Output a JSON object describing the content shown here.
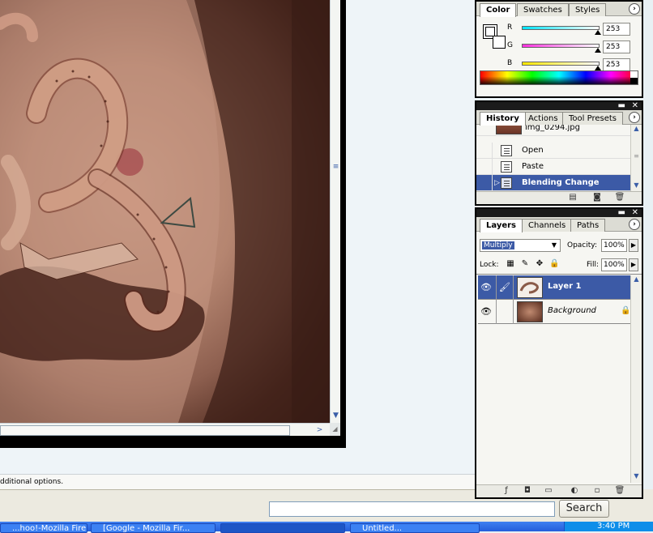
{
  "status_bar": {
    "text": "dditional options."
  },
  "browser": {
    "search_label": "Search"
  },
  "taskbar": {
    "items": [
      "...hoo!-Mozilla Fire...",
      "[Google - Mozilla Fir...",
      "",
      "Untitled..."
    ],
    "clock": "3:40 PM"
  },
  "color_palette": {
    "tabs": [
      "Color",
      "Swatches",
      "Styles"
    ],
    "active_tab": "Color",
    "channels": [
      {
        "label": "R",
        "value": "253",
        "color": "#00e5ff"
      },
      {
        "label": "G",
        "value": "253",
        "color": "#ff30e0"
      },
      {
        "label": "B",
        "value": "253",
        "color": "#ffe800"
      }
    ]
  },
  "history_palette": {
    "tabs": [
      "History",
      "Actions",
      "Tool Presets"
    ],
    "active_tab": "History",
    "snapshot_label": "img_0294.jpg",
    "steps": [
      {
        "label": "Open",
        "selected": false
      },
      {
        "label": "Paste",
        "selected": false
      },
      {
        "label": "Blending Change",
        "selected": true
      }
    ]
  },
  "layers_palette": {
    "tabs": [
      "Layers",
      "Channels",
      "Paths"
    ],
    "active_tab": "Layers",
    "blend_mode": "Multiply",
    "opacity_label": "Opacity:",
    "opacity_value": "100%",
    "lock_label": "Lock:",
    "fill_label": "Fill:",
    "fill_value": "100%",
    "layers": [
      {
        "name": "Layer 1",
        "selected": true,
        "visible": true
      },
      {
        "name": "Background",
        "selected": false,
        "visible": true,
        "locked": true
      }
    ]
  },
  "icons": {
    "eye": "eye-icon",
    "brush": "brush-icon",
    "lock": "lock-icon"
  }
}
